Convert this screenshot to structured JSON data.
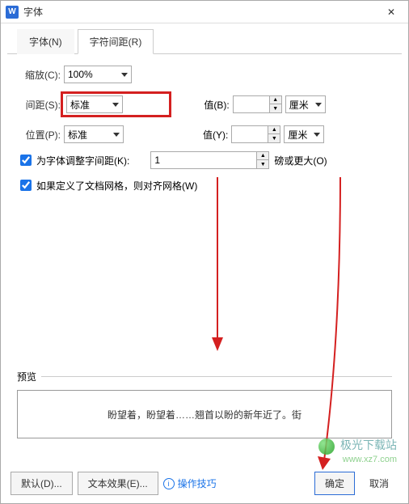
{
  "title": "字体",
  "app_icon_letter": "W",
  "tabs": {
    "font": "字体(N)",
    "spacing": "字符间距(R)"
  },
  "labels": {
    "scale": "缩放(C):",
    "spacing": "间距(S):",
    "position": "位置(P):",
    "valueB": "值(B):",
    "valueY": "值(Y):",
    "unit_cm": "厘米",
    "kern": "为字体调整字间距(K):",
    "kern_unit": "磅或更大(O)",
    "snap": "如果定义了文档网格，则对齐网格(W)"
  },
  "values": {
    "scale": "100%",
    "spacing": "标准",
    "position": "标准",
    "valueB": "",
    "valueY": "",
    "kern_value": "1"
  },
  "preview": {
    "title": "预览",
    "text": "盼望着，盼望着……翘首以盼的新年近了。街"
  },
  "buttons": {
    "default": "默认(D)...",
    "text_effect": "文本效果(E)...",
    "tips": "操作技巧",
    "ok": "确定",
    "cancel": "取消"
  },
  "watermark": {
    "line1": "极光下载站",
    "line2": "www.xz7.com"
  }
}
